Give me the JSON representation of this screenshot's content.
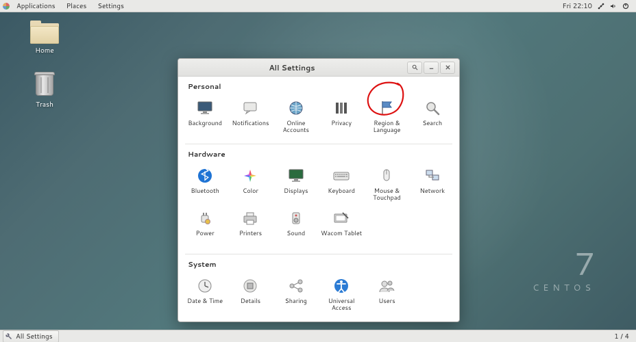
{
  "topbar": {
    "menus": {
      "apps": "Applications",
      "places": "Places",
      "settings": "Settings"
    },
    "clock": "Fri 22:10"
  },
  "desktop_icons": {
    "home": "Home",
    "trash": "Trash"
  },
  "branding": {
    "version": "7",
    "distro": "CENTOS"
  },
  "taskbar": {
    "active_app": "All Settings",
    "workspace": "1 / 4"
  },
  "window": {
    "title": "All Settings",
    "sections": {
      "personal": "Personal",
      "hardware": "Hardware",
      "system": "System"
    },
    "items": {
      "background": "Background",
      "notifications": "Notifications",
      "online": "Online Accounts",
      "privacy": "Privacy",
      "region": "Region & Language",
      "search": "Search",
      "bluetooth": "Bluetooth",
      "color": "Color",
      "displays": "Displays",
      "keyboard": "Keyboard",
      "mouse": "Mouse & Touchpad",
      "network": "Network",
      "power": "Power",
      "printers": "Printers",
      "sound": "Sound",
      "wacom": "Wacom Tablet",
      "datetime": "Date & Time",
      "details": "Details",
      "sharing": "Sharing",
      "ua": "Universal Access",
      "users": "Users"
    }
  },
  "annotation": {
    "highlighted_item": "region"
  }
}
